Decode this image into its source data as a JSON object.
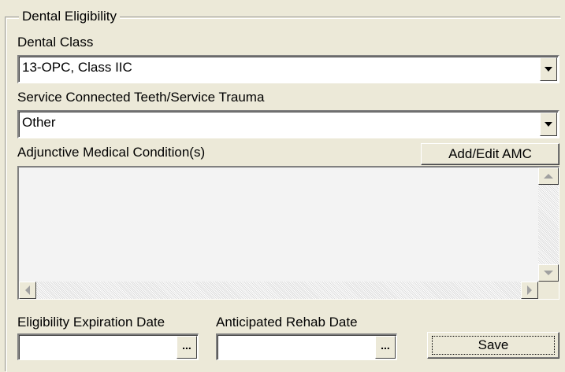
{
  "group": {
    "title": "Dental Eligibility"
  },
  "dental_class": {
    "label": "Dental Class",
    "value": "13-OPC, Class IIC"
  },
  "service_connected": {
    "label": "Service Connected Teeth/Service Trauma",
    "value": "Other"
  },
  "amc": {
    "label": "Adjunctive Medical Condition(s)",
    "button_label": "Add/Edit AMC",
    "items": []
  },
  "eligibility_expiration": {
    "label": "Eligibility Expiration Date",
    "value": "",
    "button_label": "..."
  },
  "anticipated_rehab": {
    "label": "Anticipated Rehab Date",
    "value": "",
    "button_label": "..."
  },
  "save": {
    "label": "Save"
  },
  "icons": {
    "dropdown": "chevron-down-icon",
    "scroll_up": "arrow-up-icon",
    "scroll_down": "arrow-down-icon",
    "scroll_left": "arrow-left-icon",
    "scroll_right": "arrow-right-icon"
  }
}
